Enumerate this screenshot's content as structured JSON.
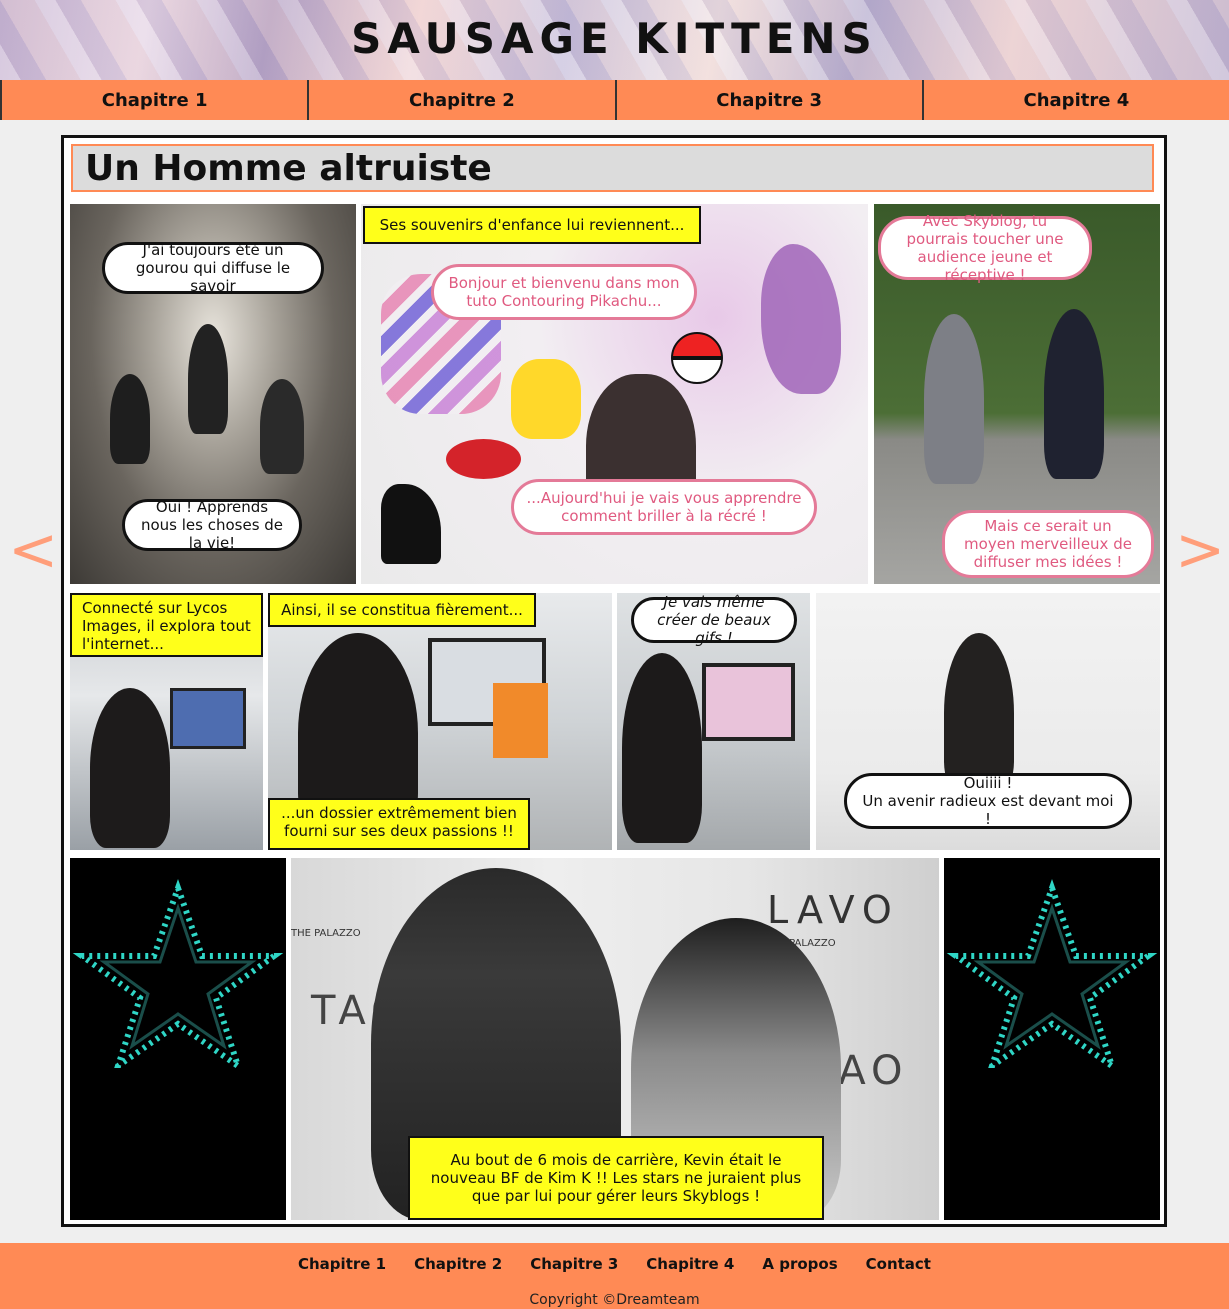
{
  "site": {
    "title": "SAUSAGE KITTENS"
  },
  "nav": {
    "items": [
      {
        "label": "Chapitre 1"
      },
      {
        "label": "Chapitre 2"
      },
      {
        "label": "Chapitre 3"
      },
      {
        "label": "Chapitre 4"
      }
    ]
  },
  "arrows": {
    "prev": "<",
    "next": ">"
  },
  "comic": {
    "title": "Un Homme altruiste",
    "panel1": {
      "bubble_top": "J'ai toujours été un gourou qui diffuse le savoir",
      "bubble_bottom": "Oui ! Apprends nous les choses de la vie!"
    },
    "panel2": {
      "caption": "Ses souvenirs d'enfance lui reviennent...",
      "bubble_top": "Bonjour et bienvenu dans mon tuto Contouring Pikachu...",
      "bubble_bottom": "...Aujourd'hui je vais vous apprendre comment briller à la récré !"
    },
    "panel3": {
      "bubble_top": "Avec Skyblog, tu pourrais toucher une audience jeune et réceptive !",
      "bubble_bottom": "Mais ce serait un moyen merveilleux de diffuser mes idées !"
    },
    "panel4": {
      "caption": "Connecté sur Lycos Images, il explora tout l'internet..."
    },
    "panel5": {
      "caption_top": "Ainsi, il se constitua fièrement...",
      "caption_bottom": "...un dossier extrêmement bien fourni sur ses deux passions !!"
    },
    "panel6": {
      "bubble": "Je vais même créer de beaux gifs !"
    },
    "panel7": {
      "bubble_line1": "Ouiiii !",
      "bubble_line2": "Un avenir radieux est devant moi !"
    },
    "panel9": {
      "caption": "Au bout de 6 mois de carrière, Kevin était le nouveau BF de Kim K !! Les stars ne juraient plus que par lui pour gérer leurs Skyblogs !",
      "sign_words": [
        "LAVO",
        "TAO",
        "THE PALAZZO"
      ]
    }
  },
  "footer": {
    "links": [
      {
        "label": "Chapitre 1"
      },
      {
        "label": "Chapitre 2"
      },
      {
        "label": "Chapitre 3"
      },
      {
        "label": "Chapitre 4"
      },
      {
        "label": "A propos"
      },
      {
        "label": "Contact"
      }
    ],
    "copyright": "Copyright ©Dreamteam"
  },
  "colors": {
    "accent": "#ff8a55",
    "caption": "#ffff1a",
    "pink": "#e47a98"
  }
}
